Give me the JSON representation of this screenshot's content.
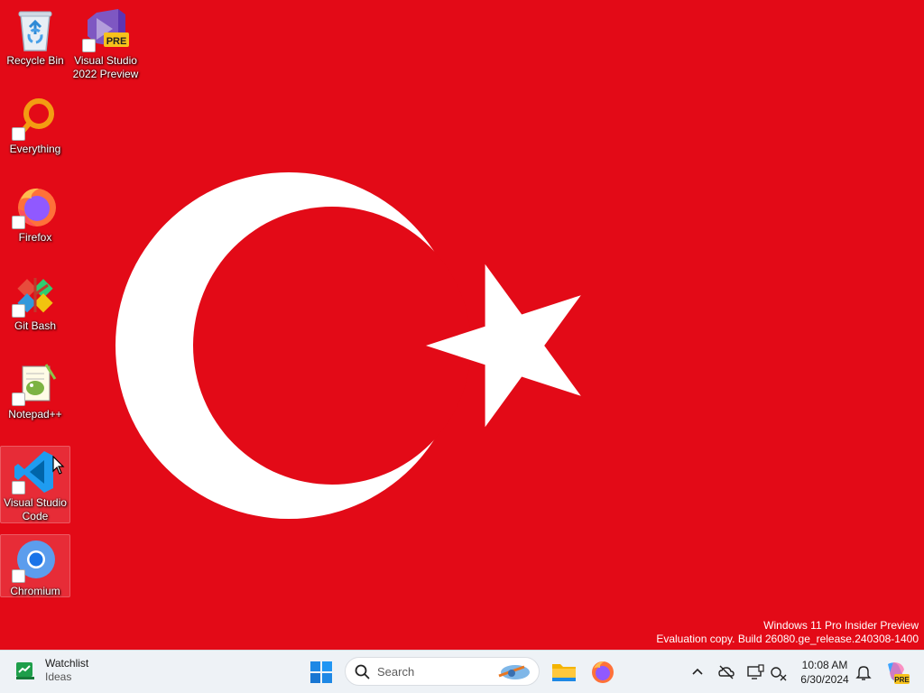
{
  "desktop": {
    "wallpaper": {
      "description_colors": {
        "background": "#e30a17",
        "symbol": "#ffffff"
      }
    },
    "icons": [
      {
        "key": "recycle-bin",
        "label": "Recycle Bin",
        "icon": "recycle-bin-icon"
      },
      {
        "key": "visual-studio-2022-preview",
        "label": "Visual Studio\n2022 Preview",
        "icon": "visual-studio-preview-icon",
        "badge": "PRE"
      },
      {
        "key": "everything",
        "label": "Everything",
        "icon": "everything-search-icon"
      },
      {
        "key": "firefox",
        "label": "Firefox",
        "icon": "firefox-icon"
      },
      {
        "key": "git-bash",
        "label": "Git Bash",
        "icon": "git-bash-icon"
      },
      {
        "key": "notepad-plus-plus",
        "label": "Notepad++",
        "icon": "notepad-plus-plus-icon"
      },
      {
        "key": "visual-studio-code",
        "label": "Visual Studio\nCode",
        "icon": "vscode-icon"
      },
      {
        "key": "chromium",
        "label": "Chromium",
        "icon": "chromium-icon"
      }
    ],
    "watermark": {
      "line1": "Windows 11 Pro Insider Preview",
      "line2": "Evaluation copy. Build 26080.ge_release.240308-1400"
    }
  },
  "taskbar": {
    "widget": {
      "title": "Watchlist",
      "subtitle": "Ideas"
    },
    "search": {
      "placeholder": "Search"
    },
    "pinned_apps": [
      "start-button",
      "search",
      "file-explorer",
      "firefox"
    ],
    "tray": {
      "icons": [
        "chevron-up-icon",
        "onedrive-offline-icon",
        "display-icon",
        "network-offline-icon"
      ],
      "time": "10:08 AM",
      "date": "6/30/2024"
    },
    "copilot_badge": "PRE"
  }
}
